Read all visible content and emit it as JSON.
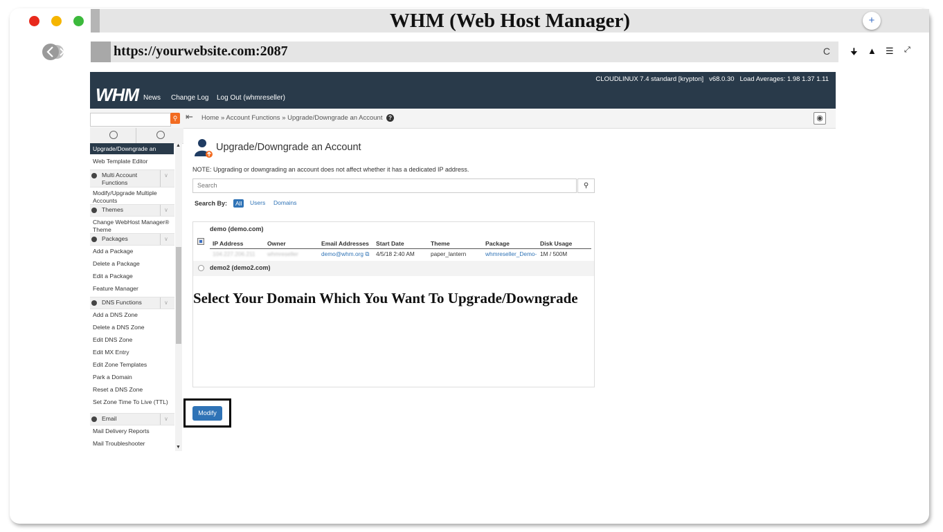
{
  "window": {
    "title": "WHM (Web Host Manager)",
    "url": "https://yourwebsite.com:2087",
    "new_tab_symbol": "+",
    "reload_symbol": "C",
    "traffic_colors": [
      "#e8291c",
      "#f5b500",
      "#3cb93c"
    ],
    "tool_icons": [
      "download-icon",
      "home-icon",
      "menu-icon",
      "expand-icon"
    ]
  },
  "header": {
    "logo": "WHM",
    "nav": [
      "News",
      "Change Log",
      "Log Out (whmreseller)"
    ],
    "status": "CLOUDLINUX 7.4 standard [krypton]   v68.0.30   Load Averages: 1.98 1.37 1.11",
    "bg_color": "#293a4a"
  },
  "breadcrumb": {
    "home": "Home",
    "sep": "»",
    "section": "Account Functions",
    "page": "Upgrade/Downgrade an Account"
  },
  "sidebar": {
    "active": "Upgrade/Downgrade an Account",
    "items": [
      {
        "type": "item",
        "label": "Web Template Editor"
      },
      {
        "type": "cat",
        "label": "Multi Account Functions"
      },
      {
        "type": "item",
        "label": "Modify/Upgrade Multiple Accounts"
      },
      {
        "type": "cat",
        "label": "Themes"
      },
      {
        "type": "item",
        "label": "Change WebHost Manager® Theme"
      },
      {
        "type": "cat",
        "label": "Packages"
      },
      {
        "type": "item",
        "label": "Add a Package"
      },
      {
        "type": "item",
        "label": "Delete a Package"
      },
      {
        "type": "item",
        "label": "Edit a Package"
      },
      {
        "type": "item",
        "label": "Feature Manager"
      },
      {
        "type": "cat",
        "label": "DNS Functions"
      },
      {
        "type": "item",
        "label": "Add a DNS Zone"
      },
      {
        "type": "item",
        "label": "Delete a DNS Zone"
      },
      {
        "type": "item",
        "label": "Edit DNS Zone"
      },
      {
        "type": "item",
        "label": "Edit MX Entry"
      },
      {
        "type": "item",
        "label": "Edit Zone Templates"
      },
      {
        "type": "item",
        "label": "Park a Domain"
      },
      {
        "type": "item",
        "label": "Reset a DNS Zone"
      },
      {
        "type": "item",
        "label": "Set Zone Time To Live (TTL)"
      },
      {
        "type": "cat",
        "label": "Email"
      },
      {
        "type": "item",
        "label": "Mail Delivery Reports"
      },
      {
        "type": "item",
        "label": "Mail Troubleshooter"
      }
    ]
  },
  "main": {
    "title": "Upgrade/Downgrade an Account",
    "note": "NOTE: Upgrading or downgrading an account does not affect whether it has a dedicated IP address.",
    "search_placeholder": "Search",
    "search_by_label": "Search By:",
    "search_by": [
      "All",
      "Users",
      "Domains"
    ],
    "accounts": [
      {
        "heading": "demo (demo.com)",
        "columns": [
          "IP Address",
          "Owner",
          "Email Addresses",
          "Start Date",
          "Theme",
          "Package",
          "Disk Usage"
        ],
        "row": {
          "ip": "104.227.206.211",
          "owner": "whmreseller",
          "email": "demo@whm.org",
          "start": "4/5/18 2:40 AM",
          "theme": "paper_lantern",
          "package": "whmreseller_Demo-2",
          "disk": "1M / 500M"
        }
      },
      {
        "heading": "demo2 (demo2.com)"
      }
    ],
    "overlay": "Select Your Domain Which You Want To Upgrade/Downgrade",
    "modify_label": "Modify"
  }
}
